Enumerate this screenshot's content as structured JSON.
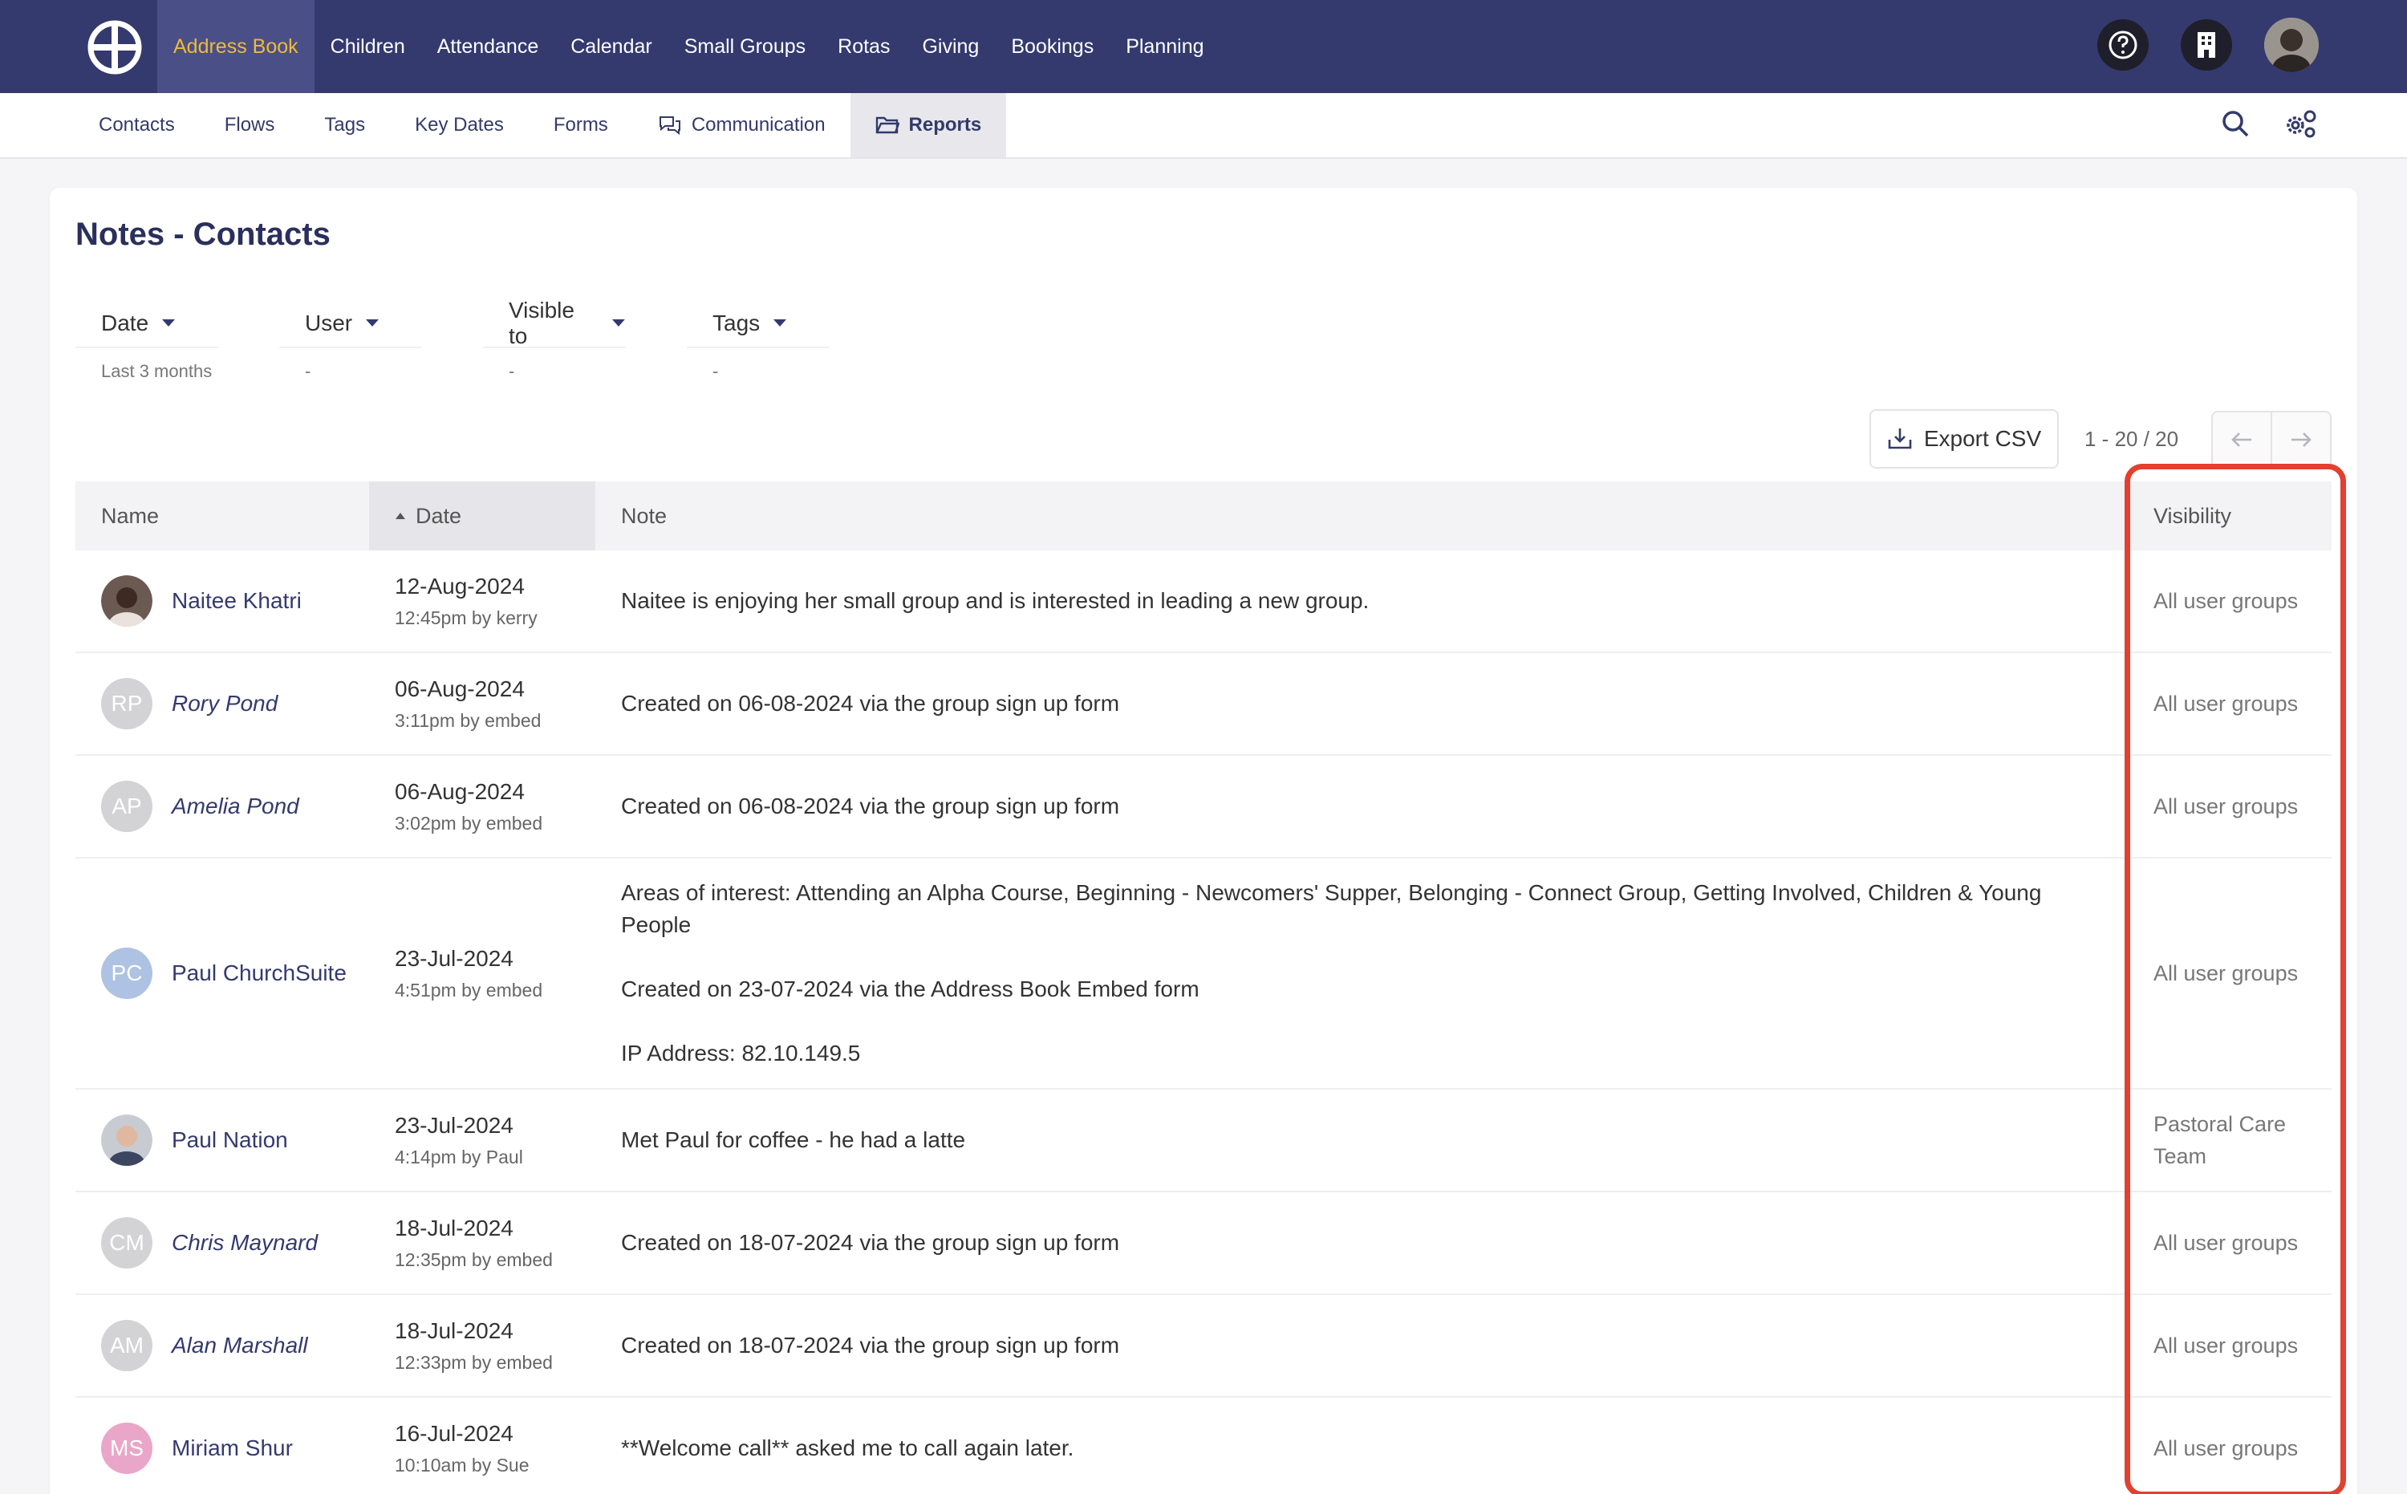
{
  "topnav": {
    "items": [
      "Address Book",
      "Children",
      "Attendance",
      "Calendar",
      "Small Groups",
      "Rotas",
      "Giving",
      "Bookings",
      "Planning"
    ],
    "active_color": "#f0b93a"
  },
  "subnav": {
    "items": [
      "Contacts",
      "Flows",
      "Tags",
      "Key Dates",
      "Forms",
      "Communication",
      "Reports"
    ]
  },
  "page": {
    "title": "Notes - Contacts"
  },
  "filters": [
    {
      "label": "Date",
      "value": "Last 3 months"
    },
    {
      "label": "User",
      "value": "-"
    },
    {
      "label": "Visible to",
      "value": "-"
    },
    {
      "label": "Tags",
      "value": "-"
    }
  ],
  "toolbar": {
    "export_label": "Export CSV",
    "pager_text": "1 - 20 / 20"
  },
  "table": {
    "headers": {
      "name": "Name",
      "date": "Date",
      "note": "Note",
      "visibility": "Visibility"
    },
    "rows": [
      {
        "initials": "",
        "avatar": "photo-dark",
        "name": "Naitee Khatri",
        "italic": false,
        "date": "12-Aug-2024",
        "sub": "12:45pm by kerry",
        "note": "Naitee is enjoying her small group and is interested in leading a new group.",
        "visibility": "All user groups"
      },
      {
        "initials": "RP",
        "avatar": "#d3d3d6",
        "name": "Rory Pond",
        "italic": true,
        "date": "06-Aug-2024",
        "sub": "3:11pm by embed",
        "note": "Created on 06-08-2024 via the group sign up form",
        "visibility": "All user groups"
      },
      {
        "initials": "AP",
        "avatar": "#d3d3d6",
        "name": "Amelia Pond",
        "italic": true,
        "date": "06-Aug-2024",
        "sub": "3:02pm by embed",
        "note": "Created on 06-08-2024 via the group sign up form",
        "visibility": "All user groups"
      },
      {
        "initials": "PC",
        "avatar": "#aec2e3",
        "name": "Paul ChurchSuite",
        "italic": false,
        "date": "23-Jul-2024",
        "sub": "4:51pm by embed",
        "note": "Areas of interest: Attending an Alpha Course, Beginning - Newcomers' Supper, Belonging - Connect Group, Getting Involved, Children & Young People\n\nCreated on 23-07-2024 via the Address Book Embed form\n\nIP Address: 82.10.149.5",
        "visibility": "All user groups"
      },
      {
        "initials": "",
        "avatar": "photo-light",
        "name": "Paul Nation",
        "italic": false,
        "date": "23-Jul-2024",
        "sub": "4:14pm by Paul",
        "note": "Met Paul for coffee - he had a latte",
        "visibility": "Pastoral Care Team"
      },
      {
        "initials": "CM",
        "avatar": "#d3d3d6",
        "name": "Chris Maynard",
        "italic": true,
        "date": "18-Jul-2024",
        "sub": "12:35pm by embed",
        "note": "Created on 18-07-2024 via the group sign up form",
        "visibility": "All user groups"
      },
      {
        "initials": "AM",
        "avatar": "#d3d3d6",
        "name": "Alan Marshall",
        "italic": true,
        "date": "18-Jul-2024",
        "sub": "12:33pm by embed",
        "note": "Created on 18-07-2024 via the group sign up form",
        "visibility": "All user groups"
      },
      {
        "initials": "MS",
        "avatar": "#e9a6c8",
        "name": "Miriam Shur",
        "italic": false,
        "date": "16-Jul-2024",
        "sub": "10:10am by Sue",
        "note": "**Welcome call** asked me to call again later.",
        "visibility": "All user groups"
      }
    ]
  },
  "icons": {
    "logo": "church-cross-logo-icon",
    "help": "question-icon",
    "building": "building-icon",
    "search": "search-icon",
    "settings": "gear-icon",
    "communication": "chat-bubbles-icon",
    "reports": "folder-icon",
    "export": "download-icon"
  },
  "colors": {
    "navbar": "#343a6e",
    "highlight": "#e3402f"
  }
}
